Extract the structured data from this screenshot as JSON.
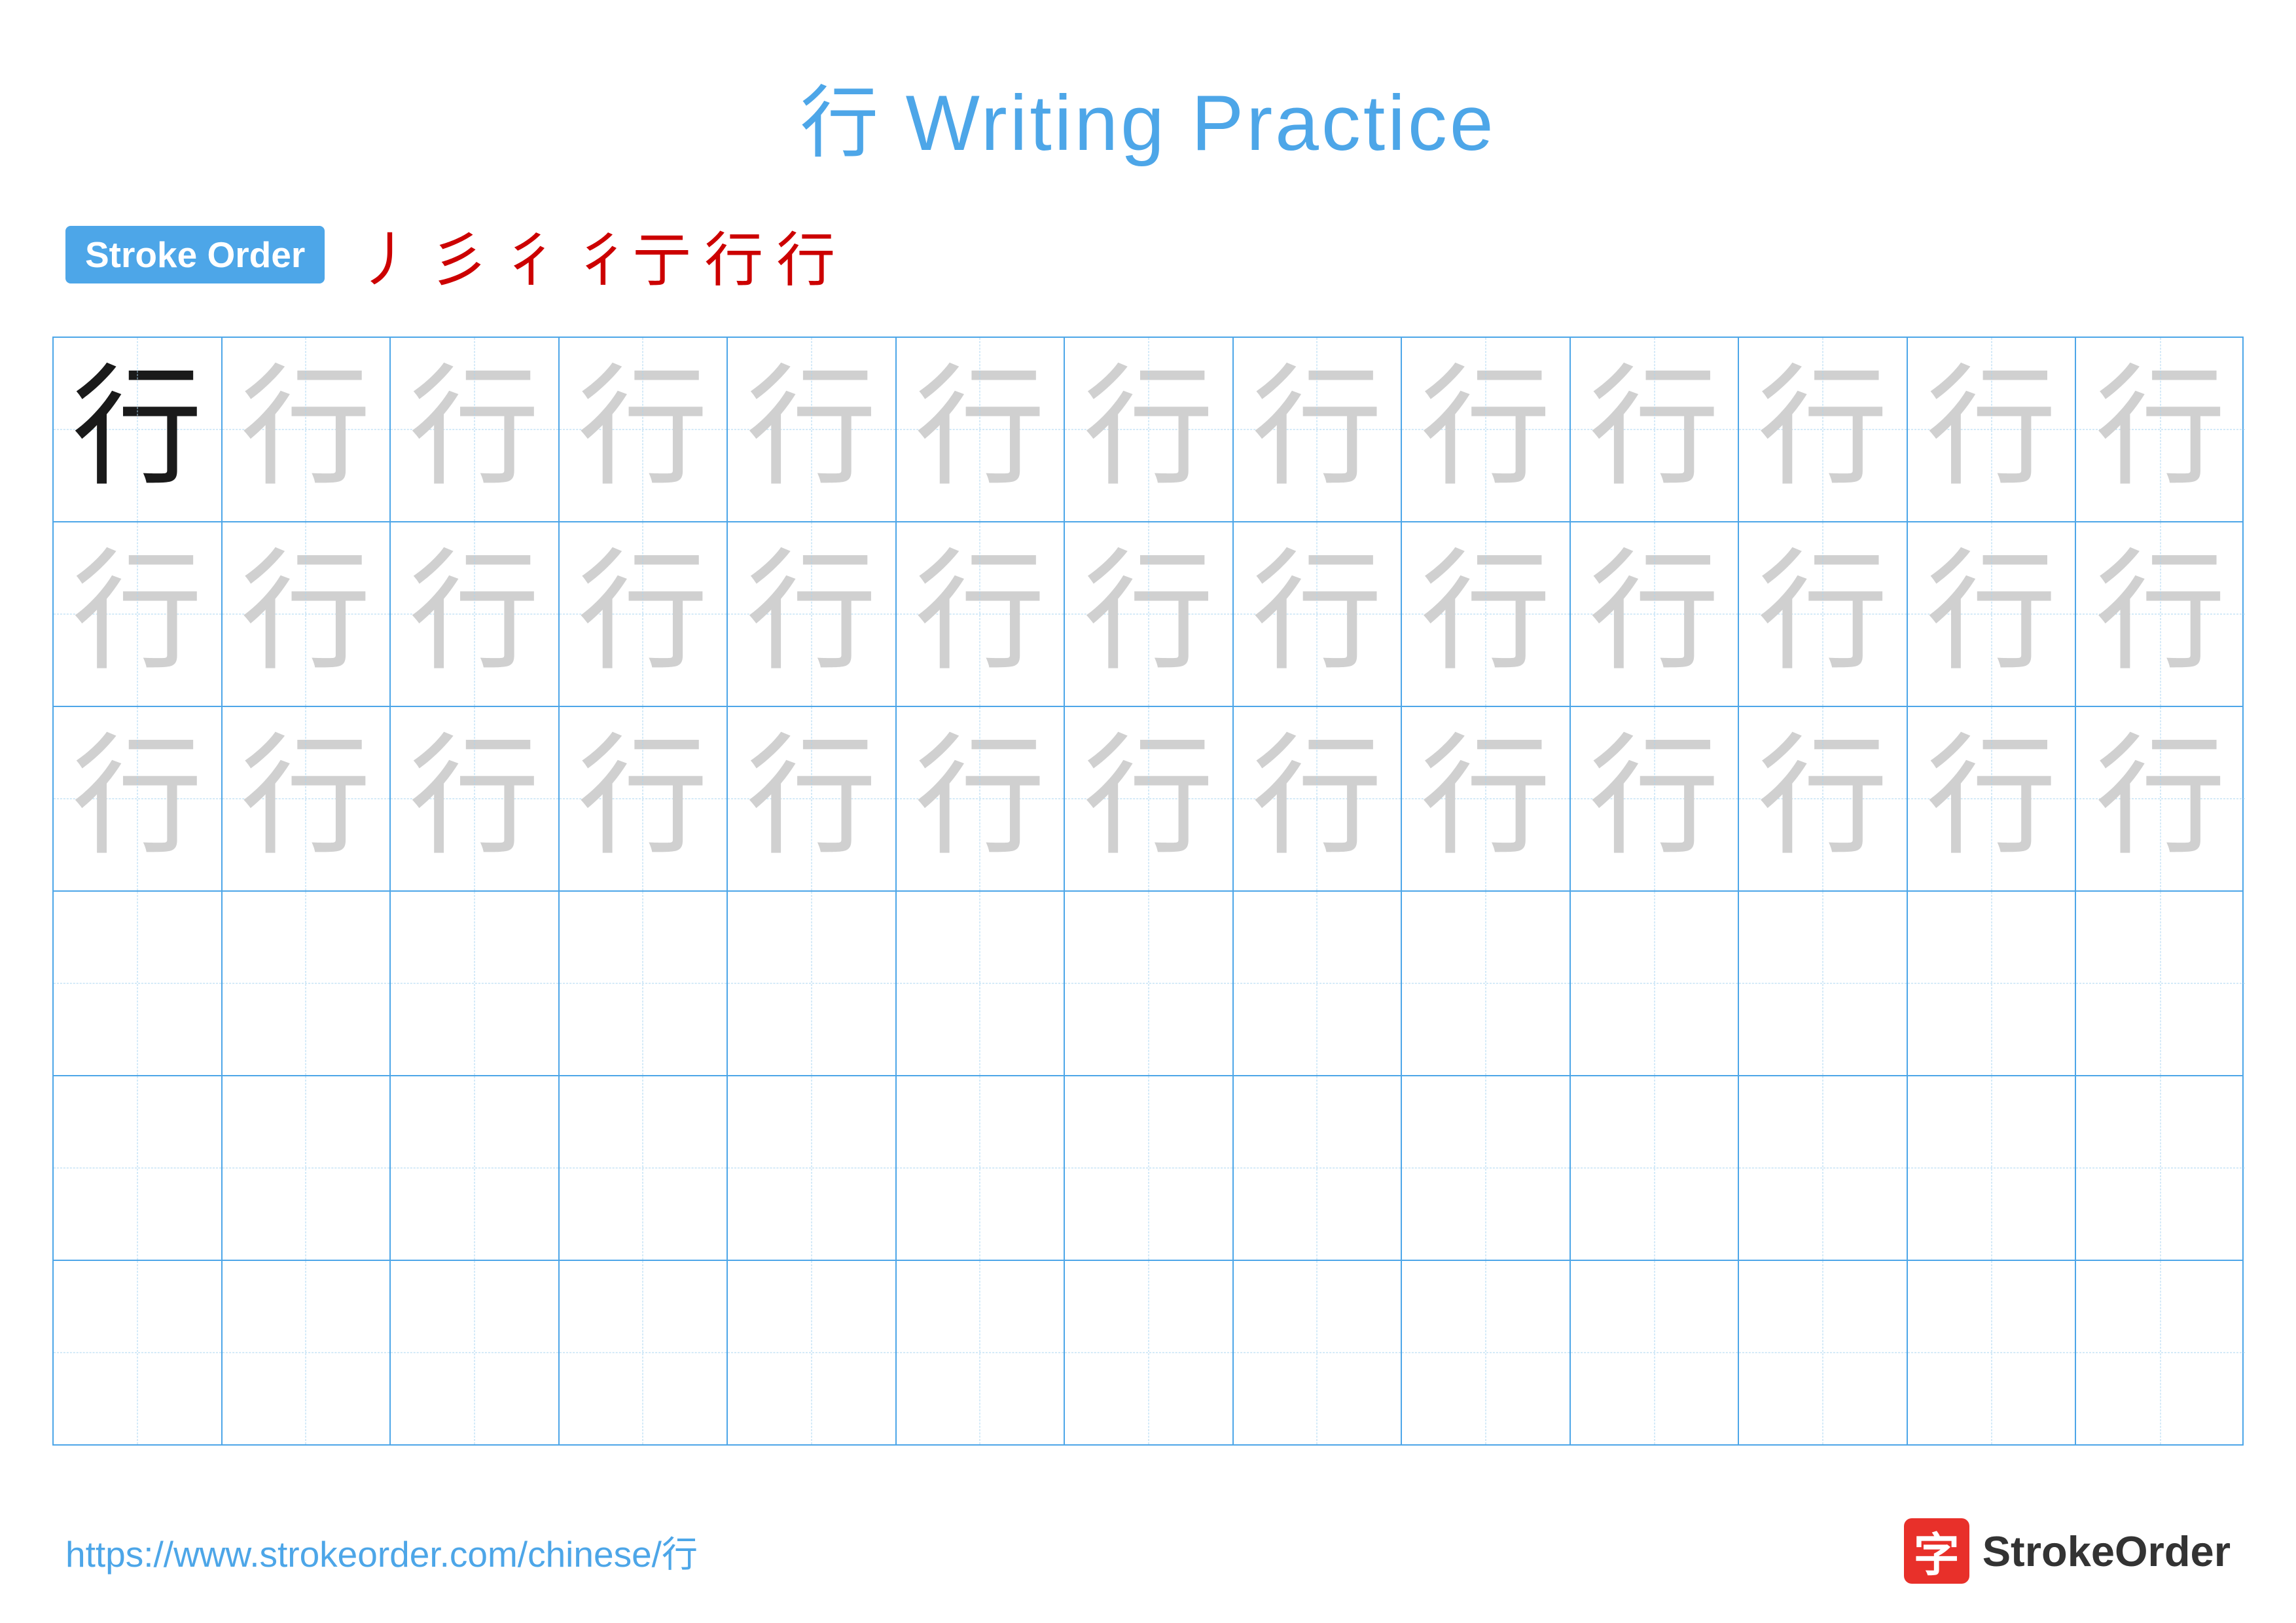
{
  "title": {
    "char": "行",
    "label": "Writing Practice",
    "full": "行 Writing Practice"
  },
  "stroke_order": {
    "badge_label": "Stroke Order",
    "strokes": [
      "丿",
      "彡",
      "彳",
      "彳亍",
      "行",
      "行"
    ]
  },
  "grid": {
    "rows": 6,
    "cols": 13,
    "char": "行",
    "row_types": [
      "dark_first_light_rest",
      "light_all",
      "light_all",
      "empty",
      "empty",
      "empty"
    ]
  },
  "footer": {
    "url": "https://www.strokeorder.com/chinese/行",
    "logo_char": "字",
    "logo_text": "StrokeOrder"
  },
  "colors": {
    "accent": "#4da6e8",
    "char_dark": "#1a1a1a",
    "char_light": "#d0d0d0",
    "grid_border": "#4da6e8",
    "grid_dashed": "#a8d4f0",
    "stroke_red": "#cc0000",
    "logo_red": "#e8302a"
  }
}
